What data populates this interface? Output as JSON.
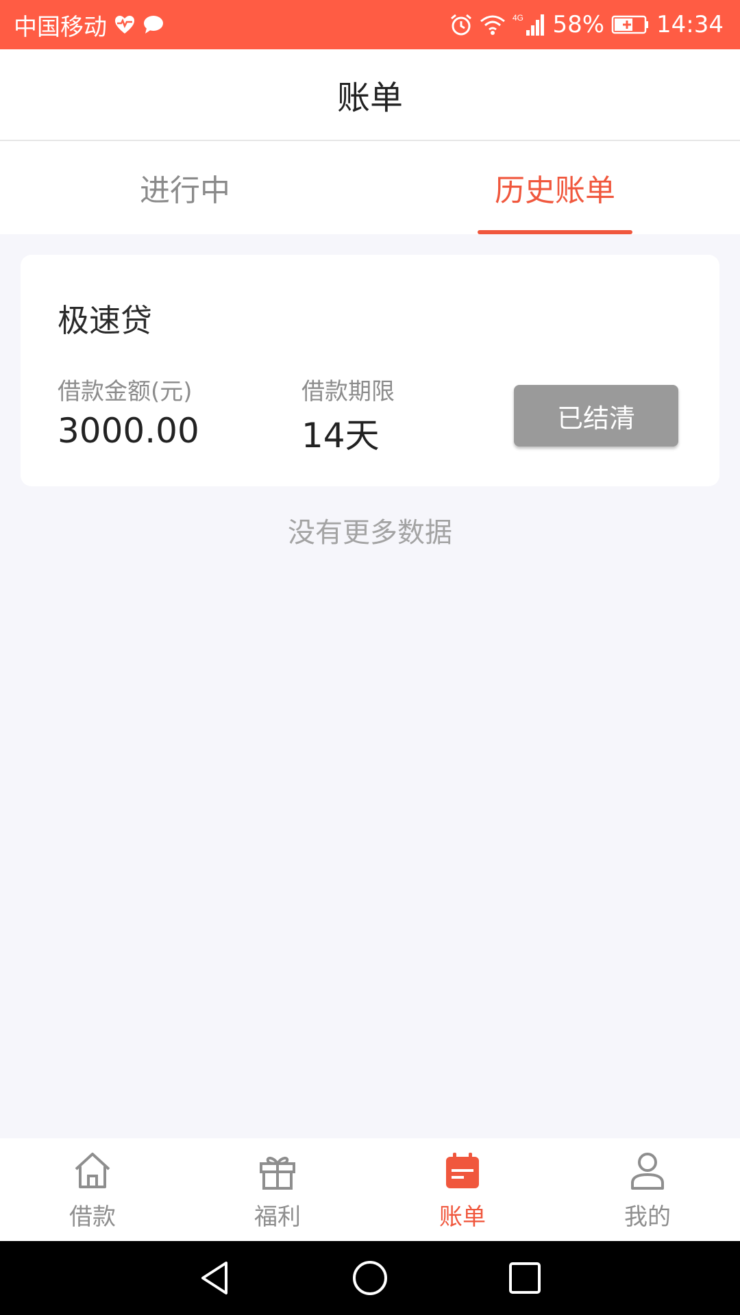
{
  "status_bar": {
    "carrier": "中国移动",
    "network": "4G",
    "battery": "58%",
    "time": "14:34"
  },
  "header": {
    "title": "账单"
  },
  "tabs": [
    {
      "label": "进行中",
      "active": false
    },
    {
      "label": "历史账单",
      "active": true
    }
  ],
  "bill": {
    "product": "极速贷",
    "amount_label": "借款金额(元)",
    "amount_value": "3000.00",
    "term_label": "借款期限",
    "term_value": "14天",
    "status_button": "已结清"
  },
  "list_end_text": "没有更多数据",
  "bottom_nav": [
    {
      "label": "借款",
      "icon": "home-icon",
      "active": false
    },
    {
      "label": "福利",
      "icon": "gift-icon",
      "active": false
    },
    {
      "label": "账单",
      "icon": "bill-icon",
      "active": true
    },
    {
      "label": "我的",
      "icon": "user-icon",
      "active": false
    }
  ],
  "colors": {
    "status_bar": "#ff5c44",
    "accent": "#f0573d",
    "settled_button": "#9a9a9a",
    "background": "#f6f6fb"
  }
}
